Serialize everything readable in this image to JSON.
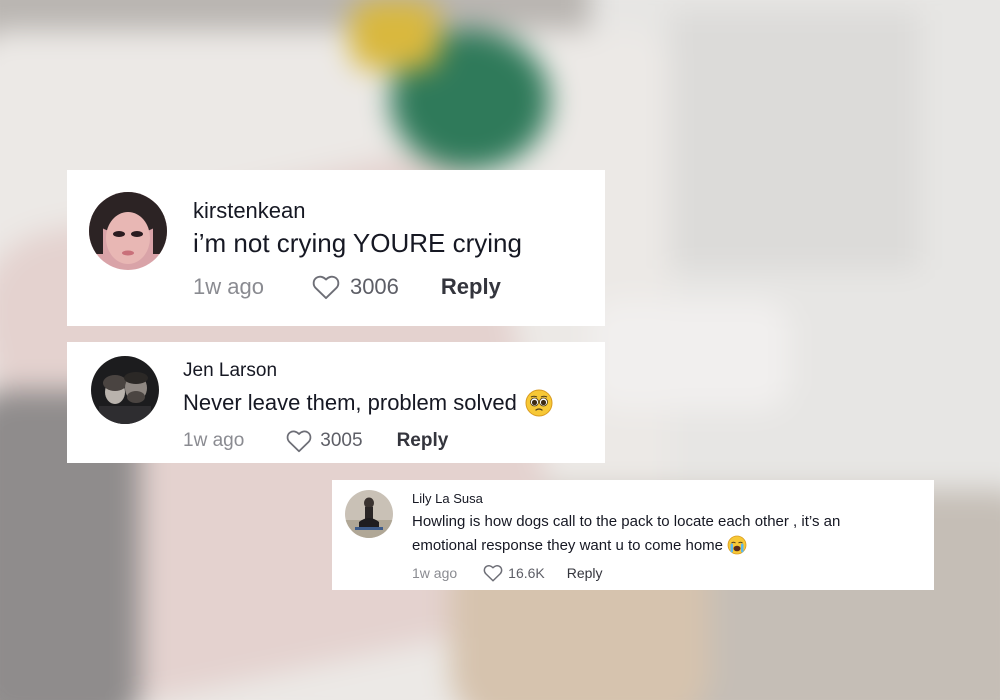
{
  "comments": [
    {
      "username": "kirstenkean",
      "text": "i’m not crying YOURE crying",
      "time": "1w ago",
      "likes": "3006",
      "reply_label": "Reply"
    },
    {
      "username": "Jen Larson",
      "text": "Never leave them, problem solved",
      "emoji": "pleading-face-icon",
      "time": "1w ago",
      "likes": "3005",
      "reply_label": "Reply"
    },
    {
      "username": "Lily La Susa",
      "text_line1": "Howling is how dogs call to the pack to locate each other , it’s an",
      "text_line2": "emotional response they want u to come home",
      "emoji": "loudly-crying-face-icon",
      "time": "1w ago",
      "likes": "16.6K",
      "reply_label": "Reply"
    }
  ],
  "colors": {
    "text_primary": "#161823",
    "text_secondary": "#8a8b91",
    "card_background": "#ffffff"
  }
}
